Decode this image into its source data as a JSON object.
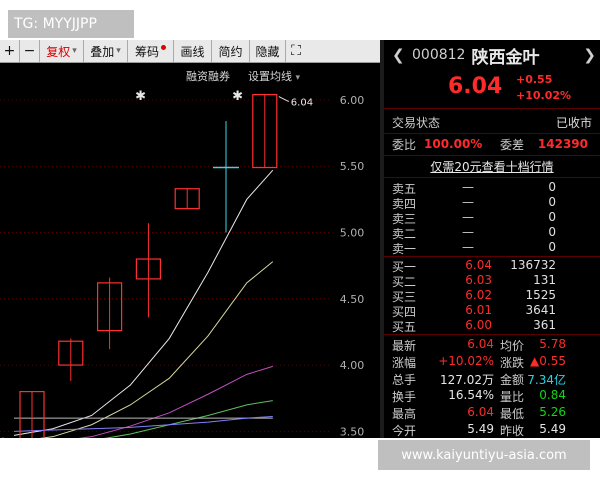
{
  "watermarks": {
    "top_left": "TG: MYYJJPP",
    "bottom_right": "www.kaiyuntiyu-asia.com"
  },
  "toolbar": {
    "plus": "+",
    "minus": "−",
    "fuquan": "复权",
    "diejia": "叠加",
    "chouma": "筹码",
    "huaxian": "画线",
    "jianyue": "简约",
    "yincang": "隐藏",
    "expand": "⛶"
  },
  "chart_links": {
    "rongzi": "融资融券",
    "junxian": "设置均线"
  },
  "chart_data": {
    "type": "candlestick",
    "title": "",
    "ylim": [
      3.45,
      6.12
    ],
    "y_ticks": [
      "6.00",
      "5.50",
      "5.00",
      "4.50",
      "4.00",
      "3.50"
    ],
    "y_tick_values": [
      6.0,
      5.5,
      5.0,
      4.5,
      4.0,
      3.5
    ],
    "candles": [
      {
        "open": 3.42,
        "high": 3.8,
        "low": 3.42,
        "close": 3.8
      },
      {
        "open": 4.0,
        "high": 4.2,
        "low": 3.88,
        "close": 4.18
      },
      {
        "open": 4.26,
        "high": 4.66,
        "low": 4.12,
        "close": 4.62
      },
      {
        "open": 4.65,
        "high": 5.07,
        "low": 4.36,
        "close": 4.8
      },
      {
        "open": 5.18,
        "high": 5.33,
        "low": 5.18,
        "close": 5.33
      },
      {
        "open": 5.49,
        "high": 5.84,
        "low": 5.0,
        "close": 5.49
      },
      {
        "open": 5.49,
        "high": 6.04,
        "low": 5.49,
        "close": 6.04
      }
    ],
    "annotation": "6.04",
    "ma_lines": [
      {
        "color": "#e8e8e8",
        "values": [
          3.47,
          3.52,
          3.62,
          3.85,
          4.2,
          4.7,
          5.25
        ]
      },
      {
        "color": "#d8d8a0",
        "values": [
          3.42,
          3.46,
          3.55,
          3.7,
          3.9,
          4.22,
          4.62
        ]
      },
      {
        "color": "#c050c0",
        "values": [
          3.4,
          3.42,
          3.46,
          3.54,
          3.64,
          3.78,
          3.93
        ]
      },
      {
        "color": "#60c060",
        "values": [
          3.38,
          3.4,
          3.43,
          3.48,
          3.55,
          3.62,
          3.7
        ]
      },
      {
        "color": "#bbbbbb",
        "values": [
          3.6,
          3.6,
          3.6,
          3.6,
          3.6,
          3.6,
          3.6
        ]
      },
      {
        "color": "#8080ff",
        "values": [
          3.5,
          3.51,
          3.52,
          3.53,
          3.55,
          3.57,
          3.6
        ]
      }
    ]
  },
  "stock": {
    "code": "000812",
    "name": "陕西金叶",
    "price": "6.04",
    "change": "+0.55",
    "change_pct": "+10.02%",
    "status_label": "交易状态",
    "status_value": "已收市",
    "weibi_label": "委比",
    "weibi_value": "100.00%",
    "weicha_label": "委差",
    "weicha_value": "142390",
    "promo": "仅需20元查看十档行情"
  },
  "sell_orders": [
    {
      "label": "卖五",
      "price": "—",
      "vol": "0"
    },
    {
      "label": "卖四",
      "price": "—",
      "vol": "0"
    },
    {
      "label": "卖三",
      "price": "—",
      "vol": "0"
    },
    {
      "label": "卖二",
      "price": "—",
      "vol": "0"
    },
    {
      "label": "卖一",
      "price": "—",
      "vol": "0"
    }
  ],
  "buy_orders": [
    {
      "label": "买一",
      "price": "6.04",
      "vol": "136732"
    },
    {
      "label": "买二",
      "price": "6.03",
      "vol": "131"
    },
    {
      "label": "买三",
      "price": "6.02",
      "vol": "1525"
    },
    {
      "label": "买四",
      "price": "6.01",
      "vol": "3641"
    },
    {
      "label": "买五",
      "price": "6.00",
      "vol": "361"
    }
  ],
  "stats": [
    {
      "l1": "最新",
      "v1": "6.04",
      "c1": "red",
      "l2": "均价",
      "v2": "5.78",
      "c2": "red"
    },
    {
      "l1": "涨幅",
      "v1": "+10.02%",
      "c1": "red",
      "l2": "涨跌",
      "v2": "▲0.55",
      "c2": "red"
    },
    {
      "l1": "总手",
      "v1": "127.02万",
      "c1": "wht",
      "l2": "金额",
      "v2": "7.34亿",
      "c2": "cyn"
    },
    {
      "l1": "换手",
      "v1": "16.54%",
      "c1": "wht",
      "l2": "量比",
      "v2": "0.84",
      "c2": "grn"
    },
    {
      "l1": "最高",
      "v1": "6.04",
      "c1": "red",
      "l2": "最低",
      "v2": "5.26",
      "c2": "grn"
    },
    {
      "l1": "今开",
      "v1": "5.49",
      "c1": "wht",
      "l2": "昨收",
      "v2": "5.49",
      "c2": "wht"
    }
  ]
}
